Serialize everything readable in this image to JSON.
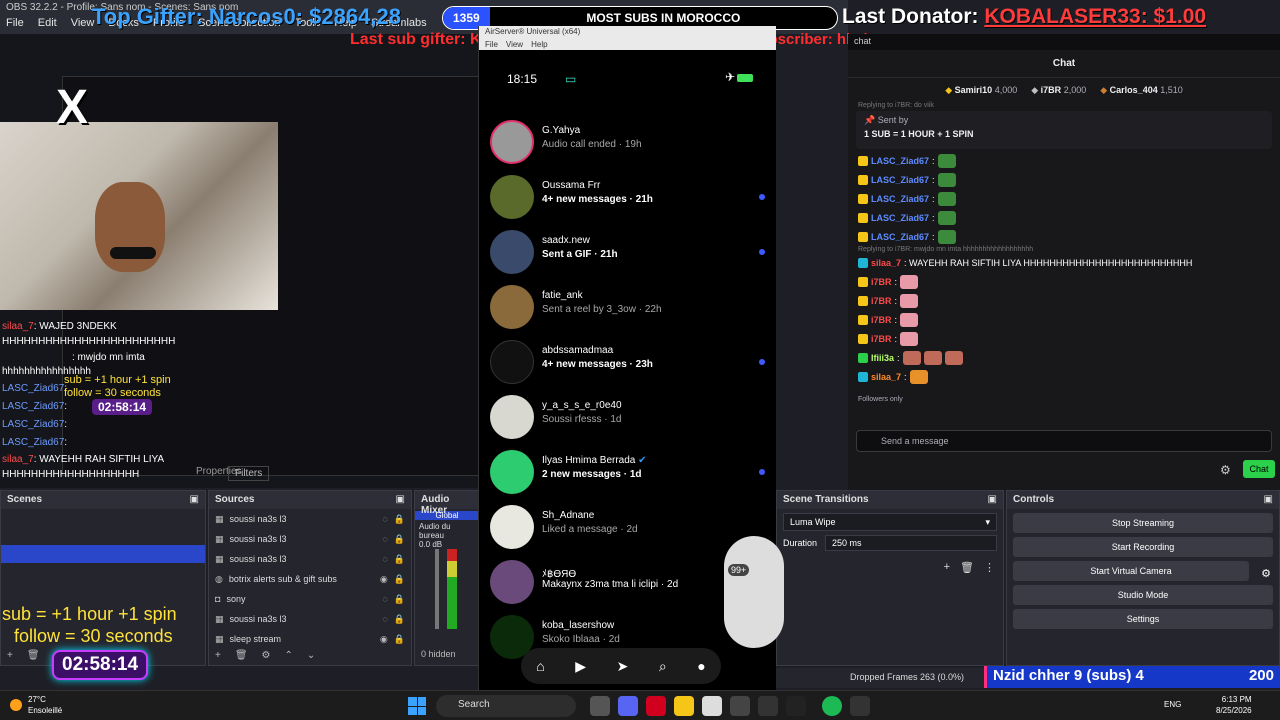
{
  "obs": {
    "title": "OBS 32.2.2 - Profile: Sans nom - Scenes: Sans nom",
    "menu": [
      "File",
      "Edit",
      "View",
      "Docks",
      "Profile",
      "Scene Collection",
      "Tools",
      "Help",
      "Streamlabs"
    ]
  },
  "overlay": {
    "top_gifter": "Top Gifter: Narcos0: $2864,28",
    "subs_count": "1359",
    "subs_goal": "MOST SUBS IN MOROCCO",
    "last_donator_label": "Last Donator:",
    "last_donator_value": "KOBALASER33: $1.00",
    "last_sub_gifter": "Last sub gifter: KOBALASER33",
    "last_subscriber": "Last subscriber: hbaine_3K",
    "logo": "X",
    "spin_small_1": "sub  = +1 hour +1 spin",
    "spin_small_2": "follow = 30 seconds",
    "spin_big_1": "sub  = +1 hour +1 spin",
    "spin_big_2": "follow = 30 seconds",
    "timer_small": "02:58:14",
    "timer_big": "02:58:14"
  },
  "mini_chat": [
    {
      "user": "silaa_7",
      "text": ": WAJED 3NDEKK"
    },
    {
      "user": "",
      "text": "HHHHHHHHHHHHHHHHHHHHHHHH"
    },
    {
      "user": "",
      "text": ": mwjdo mn imta"
    },
    {
      "user": "",
      "text": "hhhhhhhhhhhhhhhh"
    },
    {
      "user": "LASC_Ziad67",
      "text": ":"
    },
    {
      "user": "LASC_Ziad67",
      "text": ":"
    },
    {
      "user": "LASC_Ziad67",
      "text": ":"
    },
    {
      "user": "LASC_Ziad67",
      "text": ":"
    },
    {
      "user": "silaa_7",
      "text": ": WAYEHH RAH SIFTIH LIYA"
    },
    {
      "user": "",
      "text": "HHHHHHHHHHHHHHHHHHH"
    }
  ],
  "docks": {
    "scenes_title": "Scenes",
    "sources_title": "Sources",
    "mixer_title": "Audio Mixer",
    "transitions_title": "Scene Transitions",
    "controls_title": "Controls",
    "properties_tab": "Properties",
    "filters_tab": "Filters",
    "scenes": [
      "",
      "",
      "",
      "",
      ""
    ],
    "sources": [
      {
        "label": "soussi na3s l3",
        "icon": "image-icon"
      },
      {
        "label": "soussi na3s l3",
        "icon": "image-icon"
      },
      {
        "label": "soussi na3s l3",
        "icon": "image-icon"
      },
      {
        "label": "botrix alerts sub & gift subs",
        "icon": "globe-icon"
      },
      {
        "label": "sony",
        "icon": "camera-icon"
      },
      {
        "label": "soussi na3s l3",
        "icon": "image-icon"
      },
      {
        "label": "sleep stream",
        "icon": "image-icon"
      }
    ],
    "mixer_global": "Global",
    "mixer_device": "Audio du bureau",
    "mixer_db": "0.0 dB",
    "mixer_hidden": "0 hidden",
    "transition_type": "Luma Wipe",
    "duration_label": "Duration",
    "duration_value": "250 ms",
    "controls": [
      "Stop Streaming",
      "Start Recording",
      "Start Virtual Camera",
      "Studio Mode",
      "Settings"
    ]
  },
  "instagram": {
    "window_title": "AirServer® Universal (x64)",
    "window_menu": [
      "File",
      "View",
      "Help"
    ],
    "time": "18:15",
    "dms": [
      {
        "name": "G.Yahya",
        "sub": "Audio call ended · 19h",
        "unread": false
      },
      {
        "name": "Oussama Frr",
        "sub": "4+ new messages · 21h",
        "unread": true
      },
      {
        "name": "saadx.new",
        "sub": "Sent a GIF · 21h",
        "unread": true
      },
      {
        "name": "fatie_ank",
        "sub": "Sent a reel by 3_3ow · 22h",
        "unread": false
      },
      {
        "name": "abdssamadmaa",
        "sub": "4+ new messages · 23h",
        "unread": true
      },
      {
        "name": "y_a_s_s_e_r0e40",
        "sub": "Soussi rfesss · 1d",
        "unread": false
      },
      {
        "name": "Ilyas Hmima Berrada",
        "sub": "2 new messages · 1d",
        "unread": true
      },
      {
        "name": "Sh_Adnane",
        "sub": "Liked a message · 2d",
        "unread": false
      },
      {
        "name": "ﾒ฿ӨЯӨ",
        "sub": "Makaynx z3ma tma li iclipi · 2d",
        "unread": false
      },
      {
        "name": "koba_lasershow",
        "sub": "Skoko Iblaaa · 2d",
        "unread": false
      }
    ],
    "badge_count": "99+"
  },
  "chat": {
    "topbar": "chat",
    "title": "Chat",
    "leaders": [
      {
        "name": "Samiri10",
        "amount": "4,000"
      },
      {
        "name": "i7BR",
        "amount": "2,000"
      },
      {
        "name": "Carlos_404",
        "amount": "1,510"
      }
    ],
    "replying_to": "Replying to i7BR: do viik",
    "pinned_by": "Sent by",
    "pinned_text": "1 SUB = 1 HOUR + 1 SPIN",
    "messages": [
      {
        "user": "LASC_Ziad67",
        "color": "blue",
        "text": ":"
      },
      {
        "user": "LASC_Ziad67",
        "color": "blue",
        "text": ":"
      },
      {
        "user": "LASC_Ziad67",
        "color": "blue",
        "text": ":"
      },
      {
        "user": "LASC_Ziad67",
        "color": "blue",
        "text": ":"
      },
      {
        "user": "LASC_Ziad67",
        "color": "blue",
        "text": ":"
      },
      {
        "user": "silaa_7",
        "color": "red",
        "text": ": WAYEHH RAH SIFTIH LIYA HHHHHHHHHHHHHHHHHHHHHHHHHH"
      },
      {
        "user": "i7BR",
        "color": "red",
        "text": ":"
      },
      {
        "user": "i7BR",
        "color": "red",
        "text": ":"
      },
      {
        "user": "i7BR",
        "color": "red",
        "text": ":"
      },
      {
        "user": "i7BR",
        "color": "red",
        "text": ":"
      },
      {
        "user": "Ifiii3a",
        "color": "green",
        "text": ":"
      },
      {
        "user": "silaa_7",
        "color": "orange",
        "text": ":"
      }
    ],
    "reply_line": "Replying to i7BR: mwjdo mn imta hhhhhhhhhhhhhhhhhh",
    "followers_only": "Followers only",
    "input_placeholder": "Send a message",
    "send_label": "Chat"
  },
  "status": {
    "dropped_frames": "Dropped Frames 263 (0.0%)",
    "banner_text": "Nzid chher 9 (subs) 4",
    "banner_count": "200"
  },
  "taskbar": {
    "temp": "27°C",
    "weather": "Ensoleillé",
    "search": "Search",
    "lang": "ENG",
    "time": "6:13 PM",
    "date": "8/25/2026"
  },
  "colors": {
    "twitch_green": "#2bd14a",
    "obs_selection": "#2a47c9",
    "overlay_red": "#ff2e2e",
    "ig_unread_dot": "#3f5bff"
  }
}
